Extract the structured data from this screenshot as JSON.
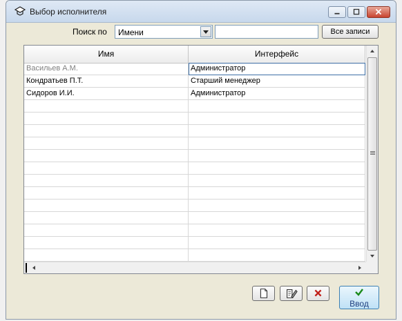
{
  "window": {
    "title": "Выбор исполнителя"
  },
  "search": {
    "label": "Поиск по",
    "field_value": "Имени",
    "query": "",
    "all_records_label": "Все записи"
  },
  "table": {
    "columns": [
      "Имя",
      "Интерфейс"
    ],
    "rows": [
      [
        "Васильев А.М.",
        "Администратор"
      ],
      [
        "Кондратьев П.Т.",
        "Старший менеджер"
      ],
      [
        "Сидоров И.И.",
        "Администратор"
      ],
      [
        "",
        ""
      ],
      [
        "",
        ""
      ],
      [
        "",
        ""
      ],
      [
        "",
        ""
      ],
      [
        "",
        ""
      ],
      [
        "",
        ""
      ],
      [
        "",
        ""
      ],
      [
        "",
        ""
      ],
      [
        "",
        ""
      ],
      [
        "",
        ""
      ],
      [
        "",
        ""
      ],
      [
        "",
        ""
      ],
      [
        "",
        ""
      ]
    ]
  },
  "buttons": {
    "enter_label": "Ввод"
  },
  "icons": {
    "title": "app-icon",
    "new": "new-document-icon",
    "edit": "edit-document-icon",
    "delete": "delete-x-icon",
    "enter": "checkmark-icon"
  }
}
